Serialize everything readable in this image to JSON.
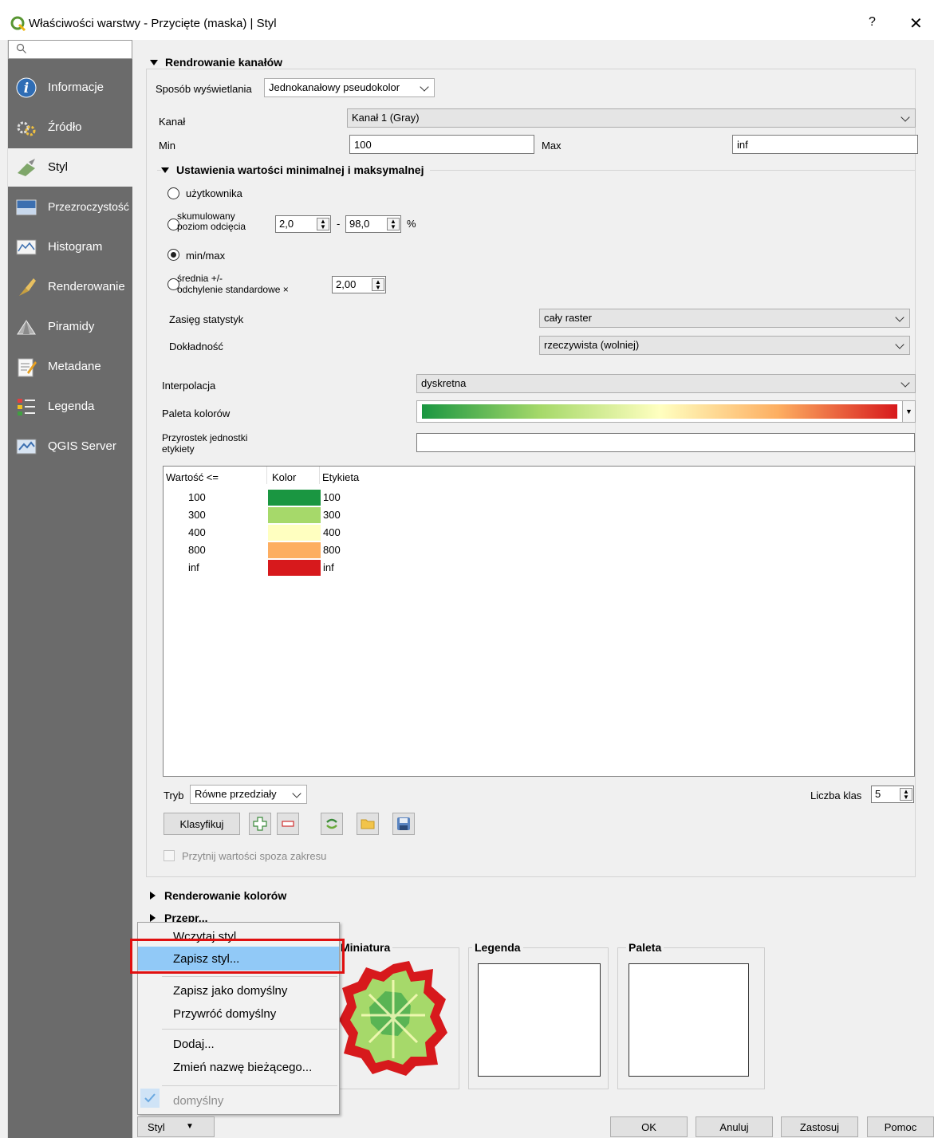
{
  "window": {
    "title": "Właściwości warstwy - Przycięte (maska) | Styl",
    "help_label": "?",
    "close_label": "✕"
  },
  "sidebar": {
    "search_placeholder": "",
    "items": [
      {
        "label": "Informacje",
        "icon": "info-icon"
      },
      {
        "label": "Źródło",
        "icon": "source-icon"
      },
      {
        "label": "Styl",
        "icon": "style-brush-icon"
      },
      {
        "label": "Przezroczystość",
        "icon": "transparency-icon"
      },
      {
        "label": "Histogram",
        "icon": "histogram-icon"
      },
      {
        "label": "Renderowanie",
        "icon": "rendering-icon"
      },
      {
        "label": "Piramidy",
        "icon": "pyramids-icon"
      },
      {
        "label": "Metadane",
        "icon": "metadata-icon"
      },
      {
        "label": "Legenda",
        "icon": "legend-icon"
      },
      {
        "label": "QGIS Server",
        "icon": "server-icon"
      }
    ],
    "active_index": 2
  },
  "band_rendering": {
    "title": "Rendrowanie kanałów",
    "render_type_label": "Sposób wyświetlania",
    "render_type_value": "Jednokanałowy pseudokolor",
    "band_label": "Kanał",
    "band_value": "Kanał 1 (Gray)",
    "min_label": "Min",
    "min_value": "100",
    "max_label": "Max",
    "max_value": "inf"
  },
  "minmax": {
    "title": "Ustawienia wartości minimalnej i maksymalnej",
    "opt_user": "użytkownika",
    "opt_cumulative_1": "skumulowany",
    "opt_cumulative_2": "poziom odcięcia",
    "cum_low": "2,0",
    "cum_dash": "-",
    "cum_high": "98,0",
    "cum_unit": "%",
    "opt_minmax": "min/max",
    "opt_stddev_1": "średnia +/-",
    "opt_stddev_2": "odchylenie standardowe ×",
    "stddev_value": "2,00",
    "selected": "min/max",
    "extent_label": "Zasięg statystyk",
    "extent_value": "cały raster",
    "accuracy_label": "Dokładność",
    "accuracy_value": "rzeczywista (wolniej)"
  },
  "interpolation": {
    "label": "Interpolacja",
    "value": "dyskretna"
  },
  "color_ramp": {
    "label": "Paleta kolorów",
    "stops": [
      "#1a9641",
      "#a6d96a",
      "#ffffc0",
      "#fdae61",
      "#d7191c"
    ]
  },
  "label_suffix": {
    "label_1": "Przyrostek jednostki",
    "label_2": "etykiety",
    "value": ""
  },
  "class_table": {
    "headers": {
      "value": "Wartość <=",
      "color": "Kolor",
      "label": "Etykieta"
    },
    "rows": [
      {
        "value": "100",
        "color": "#1a9641",
        "label": "100"
      },
      {
        "value": "300",
        "color": "#a6d96a",
        "label": "300"
      },
      {
        "value": "400",
        "color": "#ffffc0",
        "label": "400"
      },
      {
        "value": "800",
        "color": "#fdae61",
        "label": "800"
      },
      {
        "value": "inf",
        "color": "#d7191c",
        "label": "inf"
      }
    ]
  },
  "mode": {
    "label": "Tryb",
    "value": "Równe przedziały",
    "classes_label": "Liczba klas",
    "classes_value": "5"
  },
  "classify": {
    "button": "Klasyfikuj",
    "clip_label": "Przytnij wartości spoza zakresu"
  },
  "sections": {
    "color_rendering": "Renderowanie kolorów",
    "resampling_partial": "Przepr..."
  },
  "preview": {
    "miniature_label": "Miniatura",
    "legend_label": "Legenda",
    "palette_label": "Paleta"
  },
  "style_menu": {
    "items": [
      "Wczytaj styl...",
      "Zapisz styl...",
      "Zapisz jako domyślny",
      "Przywróć domyślny",
      "Dodaj...",
      "Zmień nazwę bieżącego..."
    ],
    "current": "domyślny",
    "highlighted": "Zapisz styl..."
  },
  "bottom": {
    "style_button": "Styl",
    "ok": "OK",
    "cancel": "Anuluj",
    "apply": "Zastosuj",
    "help": "Pomoc"
  }
}
